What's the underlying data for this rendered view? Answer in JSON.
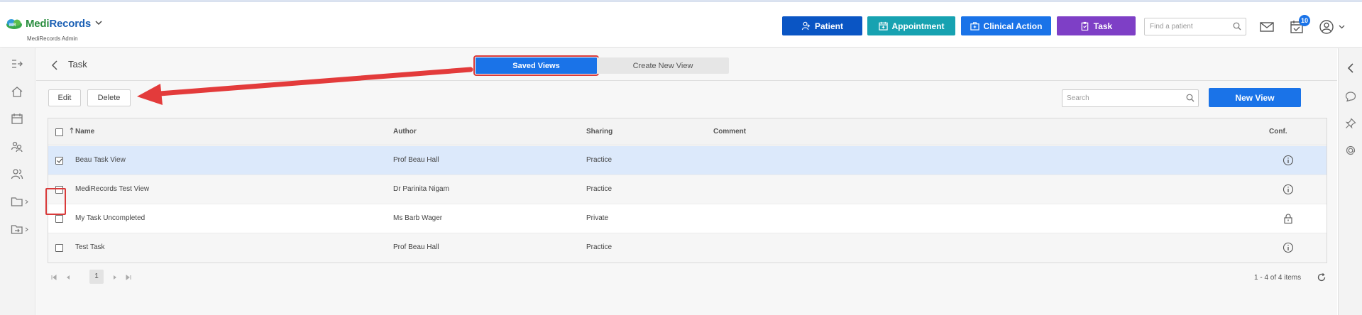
{
  "header": {
    "logo": {
      "medi": "Medi",
      "records": "Records"
    },
    "org_label": "MediRecords Admin",
    "buttons": {
      "patient": "Patient",
      "appointment": "Appointment",
      "clinical_action": "Clinical Action",
      "task": "Task"
    },
    "button_colors": {
      "patient": "#0a55c4",
      "appointment": "#17a2b1",
      "clinical_action": "#1a73e8",
      "task": "#7e3fc6"
    },
    "find_placeholder": "Find a patient",
    "notification_count": "10",
    "icons": [
      "mail-icon",
      "calendar-check-icon",
      "user-account-icon",
      "chevron-down-icon"
    ]
  },
  "left_nav": {
    "icons": [
      "collapse-menu-icon",
      "home-icon",
      "calendar-icon",
      "patients-icon",
      "users-icon",
      "folder-icon",
      "folder-share-icon"
    ]
  },
  "right_nav": {
    "icons": [
      "chevron-left-icon",
      "chat-icon",
      "pin-icon",
      "at-icon"
    ]
  },
  "page": {
    "title": "Task",
    "segments": {
      "saved": "Saved Views",
      "create": "Create New View"
    },
    "toolbar": {
      "edit": "Edit",
      "delete": "Delete",
      "search_placeholder": "Search",
      "new_view": "New View"
    }
  },
  "table": {
    "columns": {
      "name": "Name",
      "author": "Author",
      "sharing": "Sharing",
      "comment": "Comment",
      "conf": "Conf."
    },
    "rows": [
      {
        "name": "Beau Task View",
        "author": "Prof Beau Hall",
        "sharing": "Practice",
        "comment": "",
        "checked": true,
        "conf_icon": "info-icon"
      },
      {
        "name": "MediRecords Test View",
        "author": "Dr Parinita Nigam",
        "sharing": "Practice",
        "comment": "",
        "checked": false,
        "conf_icon": "info-icon"
      },
      {
        "name": "My Task Uncompleted",
        "author": "Ms Barb Wager",
        "sharing": "Private",
        "comment": "",
        "checked": false,
        "conf_icon": "lock-icon"
      },
      {
        "name": "Test Task",
        "author": "Prof Beau Hall",
        "sharing": "Practice",
        "comment": "",
        "checked": false,
        "conf_icon": "info-icon"
      }
    ]
  },
  "pager": {
    "page": "1",
    "info": "1 - 4 of 4 items"
  },
  "annotation": {
    "color": "#e33b3b"
  }
}
